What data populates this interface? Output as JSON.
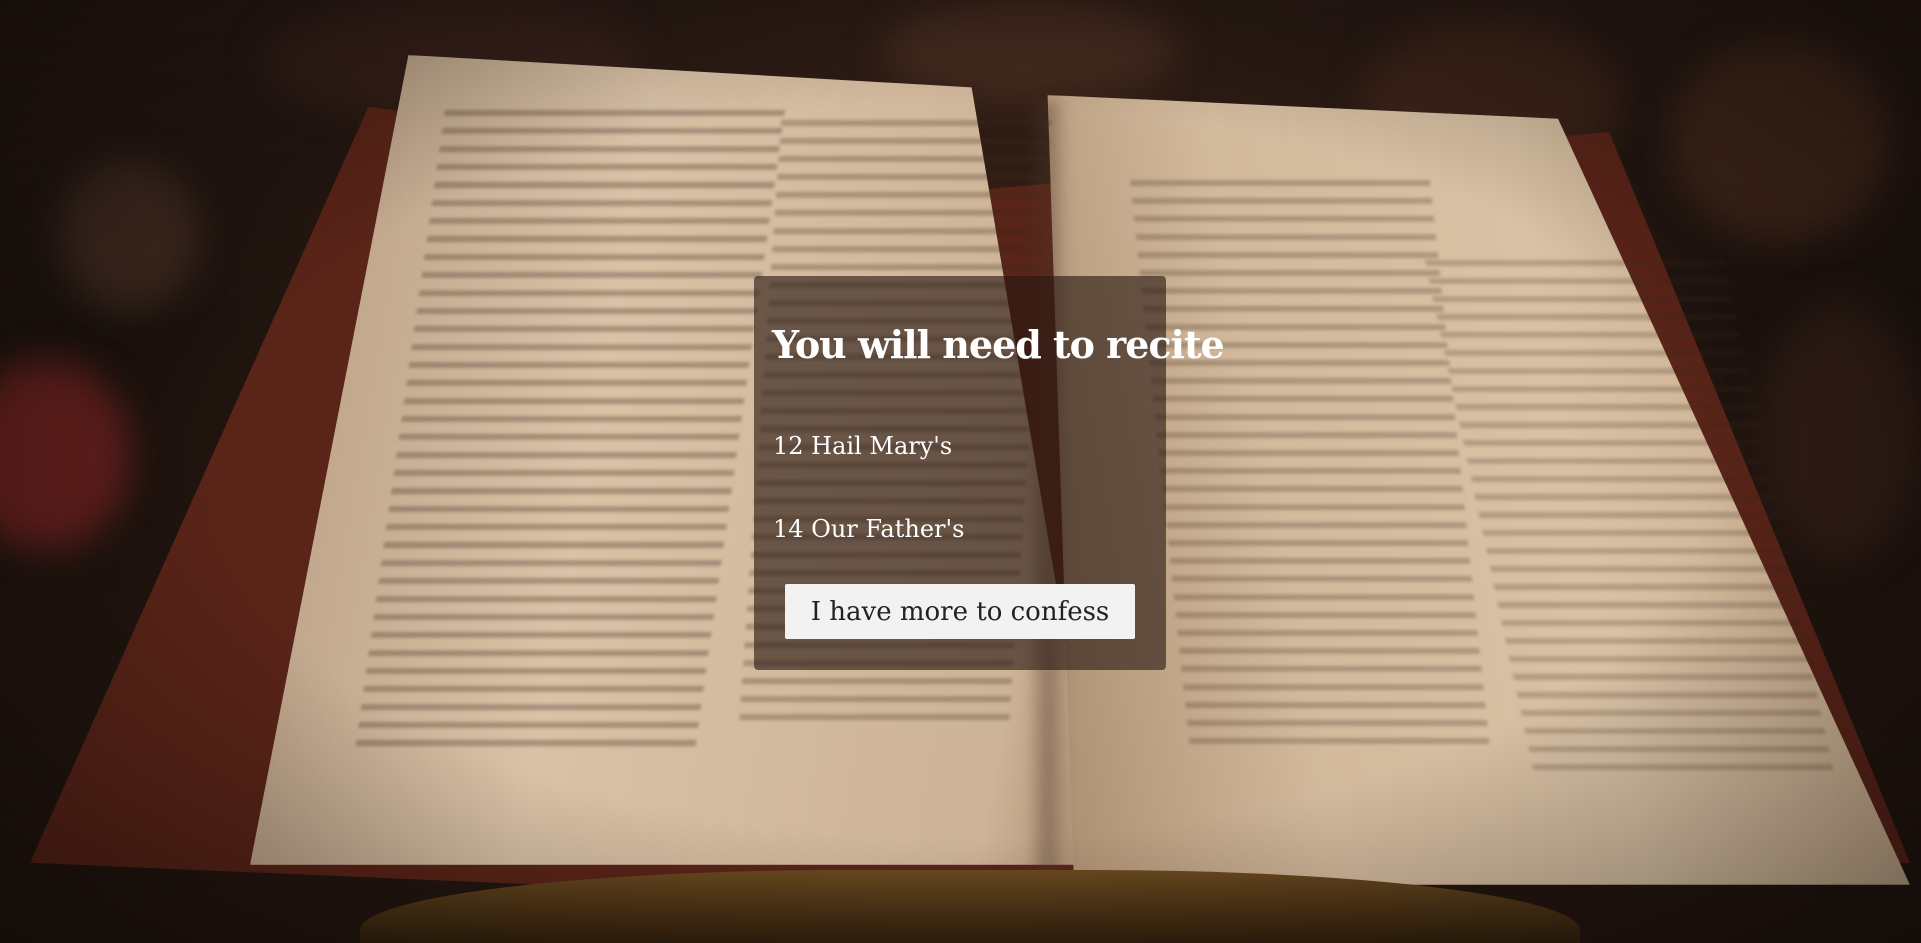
{
  "dialog": {
    "title": "You will need to recite",
    "penance": [
      {
        "label": "12 Hail Mary's"
      },
      {
        "label": "14 Our Father's"
      }
    ],
    "confess_button_label": "I have more to confess"
  }
}
